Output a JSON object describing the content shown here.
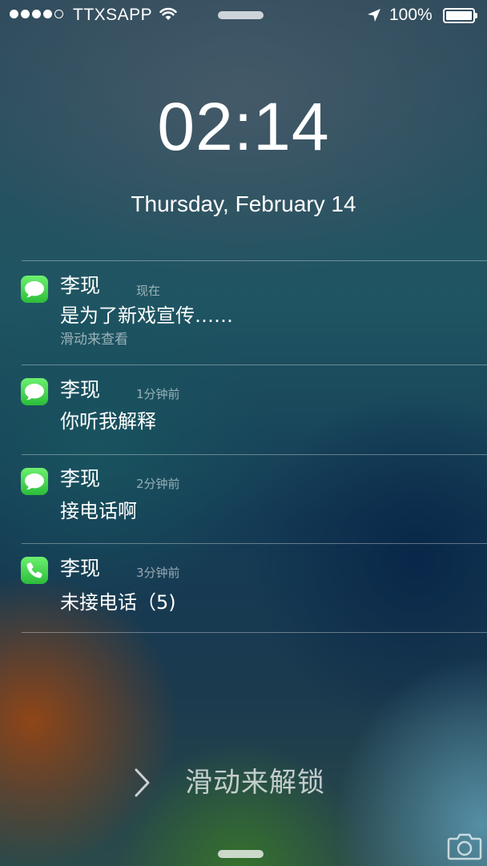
{
  "status_bar": {
    "carrier": "TTXSAPP",
    "battery_percent": "100%",
    "signal_bars_filled": 4,
    "signal_bars_total": 5,
    "icons": [
      "wifi-icon",
      "location-arrow-icon",
      "battery-icon"
    ]
  },
  "lock_screen": {
    "time": "02:14",
    "date": "Thursday, February 14"
  },
  "notifications": [
    {
      "app_icon": "messages-icon",
      "sender": "李现",
      "time": "现在",
      "message": "是为了新戏宣传……",
      "hint": "滑动来查看"
    },
    {
      "app_icon": "messages-icon",
      "sender": "李现",
      "time": "1分钟前",
      "message": "你听我解释"
    },
    {
      "app_icon": "messages-icon",
      "sender": "李现",
      "time": "2分钟前",
      "message": "接电话啊"
    },
    {
      "app_icon": "phone-icon",
      "sender": "李现",
      "time": "3分钟前",
      "message": "未接电话（5)"
    }
  ],
  "unlock": {
    "label": "滑动来解锁"
  },
  "colors": {
    "app_icon_green": "#4cd964"
  }
}
